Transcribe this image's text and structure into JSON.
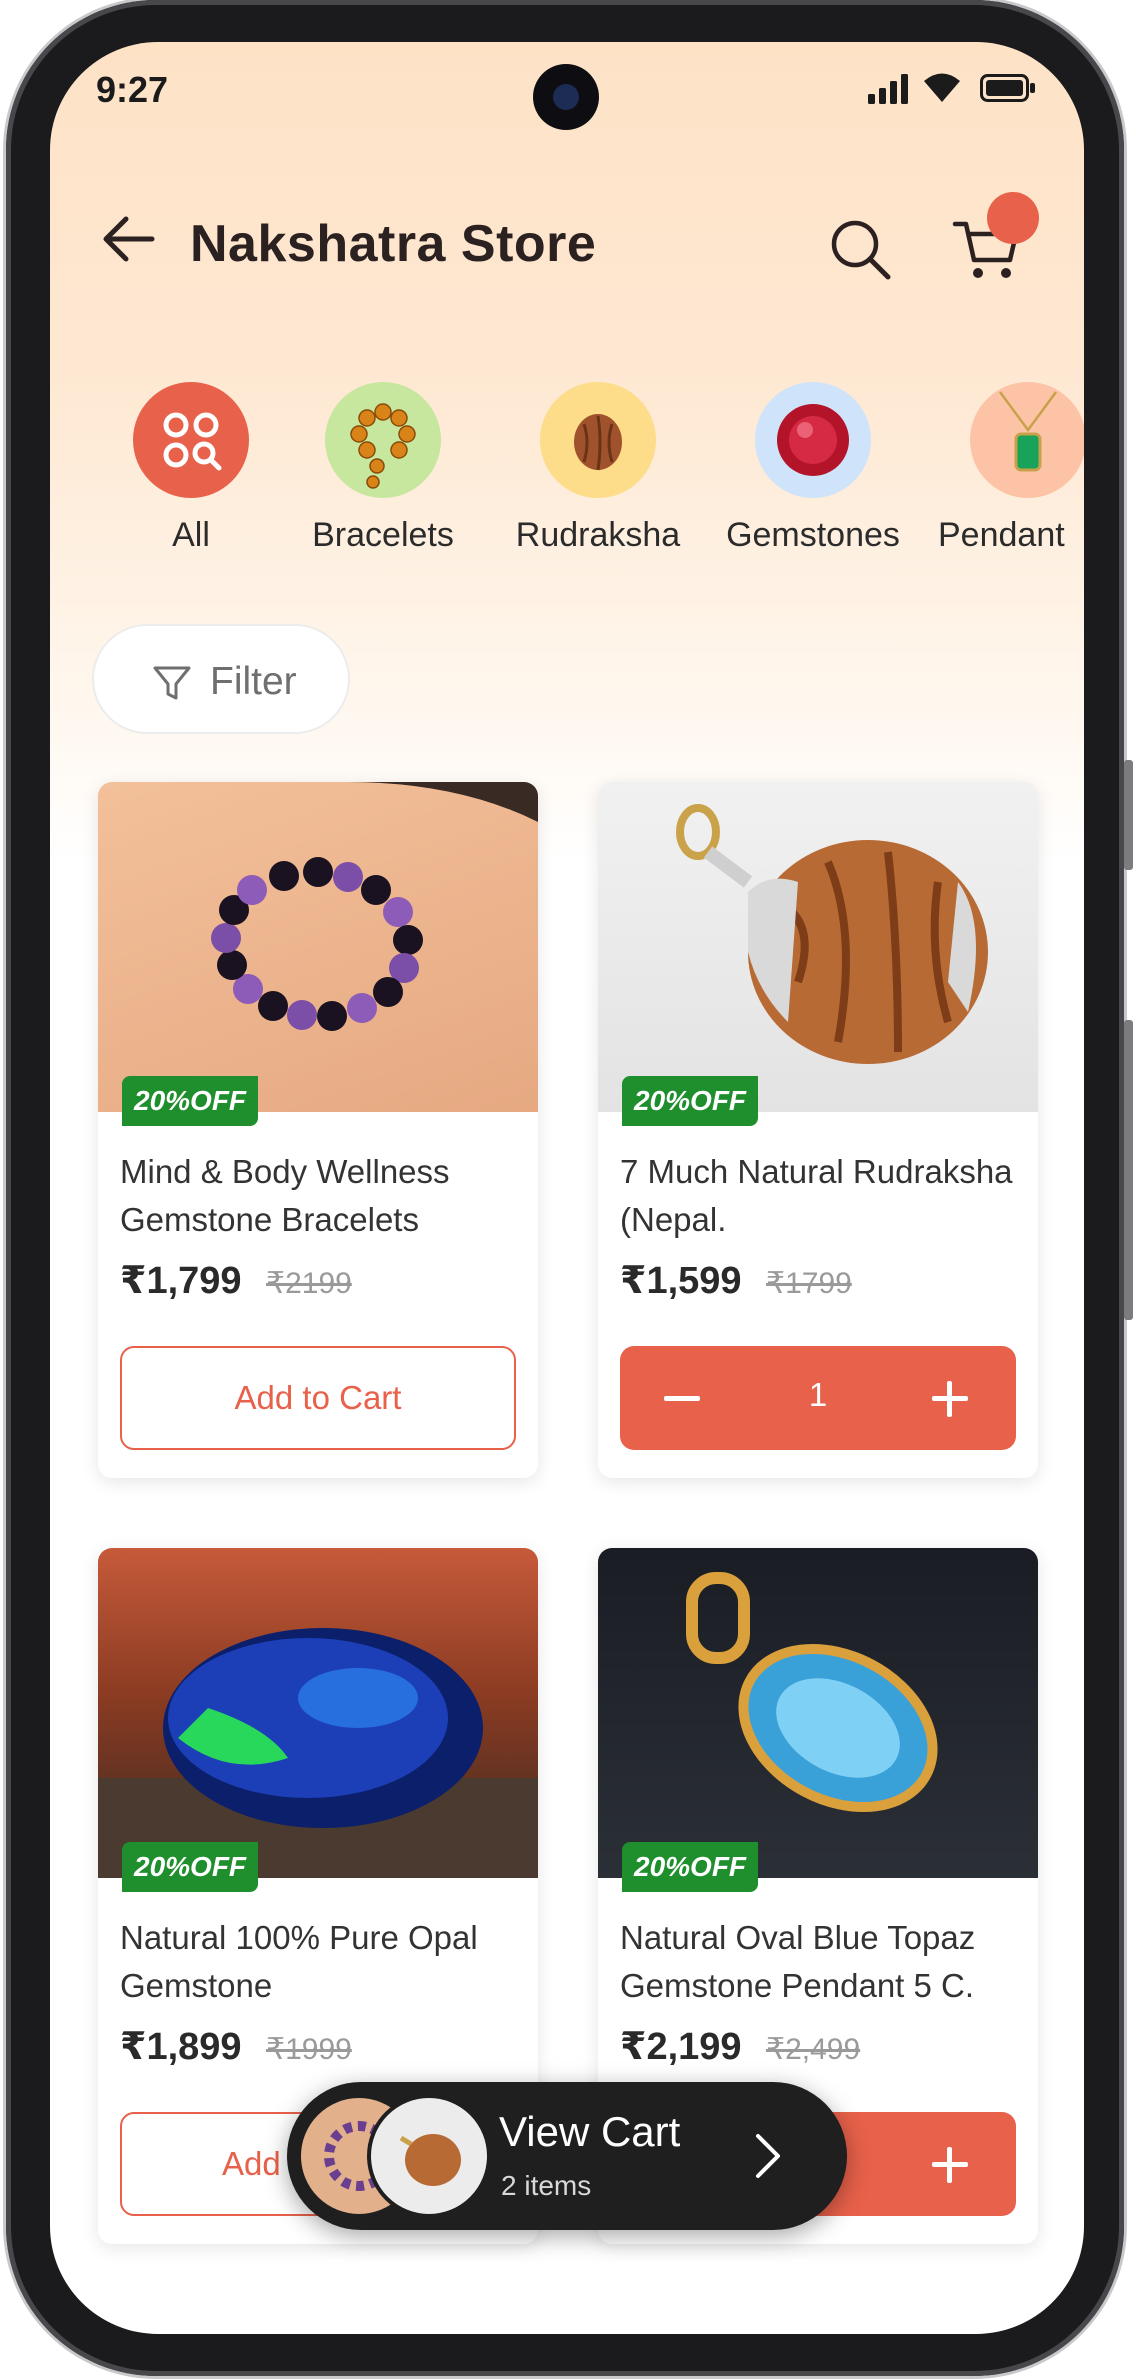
{
  "status_bar": {
    "time": "9:27"
  },
  "header": {
    "title": "Nakshatra Store"
  },
  "categories": [
    {
      "label": "All",
      "icon": "grid-search-icon"
    },
    {
      "label": "Bracelets",
      "icon": "bead-bracelet-image"
    },
    {
      "label": "Rudraksha",
      "icon": "rudraksha-bead-image"
    },
    {
      "label": "Gemstones",
      "icon": "red-gemstone-image"
    },
    {
      "label": "Pendant",
      "icon": "green-pendant-image"
    }
  ],
  "filter": {
    "label": "Filter"
  },
  "products": [
    {
      "badge": "20%OFF",
      "name": "Mind & Body Wellness Gemstone Bracelets",
      "price": "₹1,799",
      "mrp": "₹2199",
      "action": "Add to Cart"
    },
    {
      "badge": "20%OFF",
      "name": "7 Much  Natural Rudraksha (Nepal.",
      "price": "₹1,599",
      "mrp": "₹1799",
      "quantity": "1"
    },
    {
      "badge": "20%OFF",
      "name": "Natural 100% Pure Opal Gemstone",
      "price": "₹1,899",
      "mrp": "₹1999",
      "action": "Add"
    },
    {
      "badge": "20%OFF",
      "name": "Natural Oval Blue Topaz Gemstone Pendant 5 C.",
      "price": "₹2,199",
      "mrp": "₹2,499"
    }
  ],
  "view_cart": {
    "title": "View Cart",
    "subtitle": "2 items"
  },
  "colors": {
    "accent": "#e8614a",
    "badge_green": "#1f8f2e",
    "dark": "#1f1f1f"
  }
}
